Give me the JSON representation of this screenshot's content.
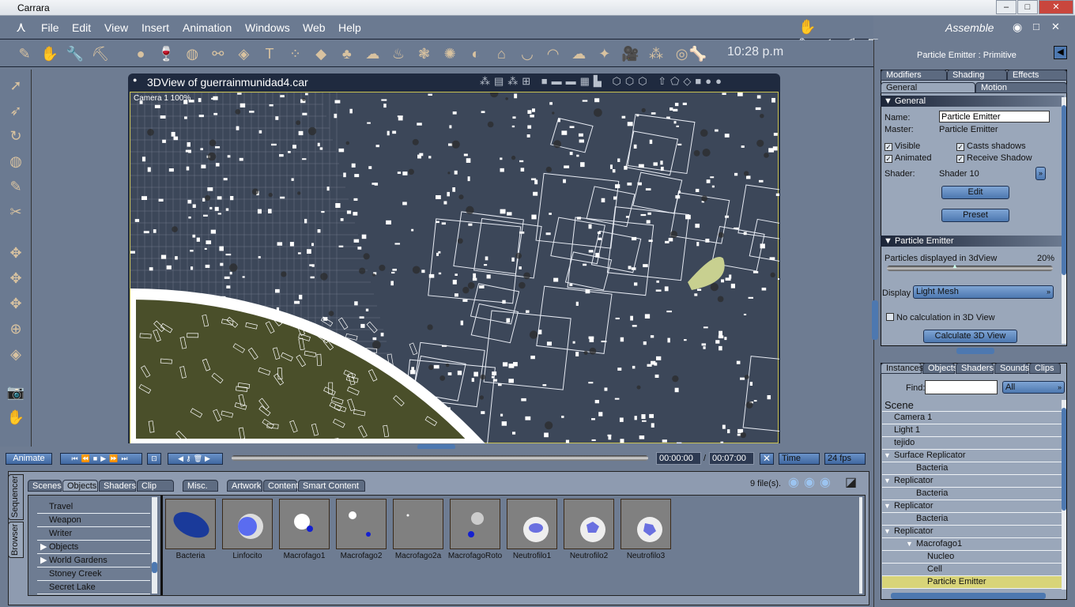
{
  "app": {
    "title": "Carrara",
    "room": "Assemble"
  },
  "menu": [
    "File",
    "Edit",
    "View",
    "Insert",
    "Animation",
    "Windows",
    "Web",
    "Help"
  ],
  "toolbar": {
    "clock": "10:28 p.m",
    "icons": [
      "move-tool-icon",
      "hand-icon",
      "wrench-icon",
      "assemble-icon",
      "sphere-icon",
      "vertex-object-icon",
      "globe-icon",
      "metaball-icon",
      "spline-icon",
      "text-icon",
      "particles-icon",
      "terrain-icon",
      "tree-icon",
      "cloud-icon",
      "fire-icon",
      "plants-icon",
      "grass-icon",
      "hair-icon",
      "house-icon",
      "landscape-icon",
      "ocean-icon",
      "atmosphere-icon",
      "light-icon",
      "camera-icon",
      "group-icon",
      "target-icon",
      "bone-icon"
    ]
  },
  "view": {
    "title": "3DView of guerrainmunidad4.car",
    "camera": "Camera 1 100%"
  },
  "properties": {
    "title": "Particle Emitter : Primitive",
    "tabs_top": [
      "Modifiers",
      "Shading",
      "Effects"
    ],
    "tabs_bottom": [
      "General",
      "Motion"
    ],
    "general_header": "General",
    "name_label": "Name:",
    "name_value": "Particle Emitter",
    "master_label": "Master:",
    "master_value": "Particle Emitter",
    "visible": "Visible",
    "casts": "Casts shadows",
    "animated": "Animated",
    "receive": "Receive Shadow",
    "shader_label": "Shader:",
    "shader_value": "Shader 10",
    "edit": "Edit",
    "preset": "Preset",
    "emitter_header": "Particle Emitter",
    "particles_label": "Particles displayed in 3dView",
    "particles_value": "20%",
    "particles_fraction": 0.2,
    "display_label": "Display",
    "display_value": "Light Mesh",
    "nocalc": "No calculation in 3D View",
    "calc": "Calculate 3D View"
  },
  "instances": {
    "tabs": [
      "Instances",
      "Objects",
      "Shaders",
      "Sounds",
      "Clips"
    ],
    "find_label": "Find:",
    "find_value": "",
    "filter": "All",
    "tree": [
      {
        "label": "Scene",
        "indent": 0
      },
      {
        "label": "Camera 1",
        "indent": 1
      },
      {
        "label": "Light 1",
        "indent": 1
      },
      {
        "label": "tejido",
        "indent": 1
      },
      {
        "label": "Surface Replicator",
        "indent": 1,
        "expand": true
      },
      {
        "label": "Bacteria",
        "indent": 2
      },
      {
        "label": "Replicator",
        "indent": 1,
        "expand": true
      },
      {
        "label": "Bacteria",
        "indent": 2
      },
      {
        "label": "Replicator",
        "indent": 1,
        "expand": true
      },
      {
        "label": "Bacteria",
        "indent": 2
      },
      {
        "label": "Replicator",
        "indent": 1,
        "expand": true
      },
      {
        "label": "Macrofago1",
        "indent": 2,
        "expand": true
      },
      {
        "label": "Nucleo",
        "indent": 3
      },
      {
        "label": "Cell",
        "indent": 3
      },
      {
        "label": "Particle Emitter",
        "indent": 3,
        "selected": true
      }
    ]
  },
  "timeline": {
    "animate": "Animate",
    "current": "00:00:00",
    "sep": "/",
    "total": "00:07:00",
    "mode": "Time",
    "fps": "24 fps"
  },
  "browser": {
    "side_tabs": [
      "Sequencer",
      "Browser"
    ],
    "tabs": [
      "Scenes",
      "Objects",
      "Shaders",
      "Clip",
      "Misc.",
      "Artwork",
      "Content",
      "Smart Content"
    ],
    "file_count": "9 file(s).",
    "library": [
      {
        "label": "Travel"
      },
      {
        "label": "Weapon"
      },
      {
        "label": "Writer"
      },
      {
        "label": "Objects",
        "arrow": true
      },
      {
        "label": "World Gardens",
        "arrow": true
      },
      {
        "label": "Stoney Creek"
      },
      {
        "label": "Secret Lake"
      }
    ],
    "items": [
      "Bacteria",
      "Linfocito",
      "Macrofago1",
      "Macrofago2",
      "Macrofago2a",
      "MacrofagoRoto",
      "Neutrofilo1",
      "Neutrofilo2",
      "Neutrofilo3"
    ]
  },
  "colors": {
    "selected": "#d8d478",
    "accent": "#4d78b0"
  }
}
